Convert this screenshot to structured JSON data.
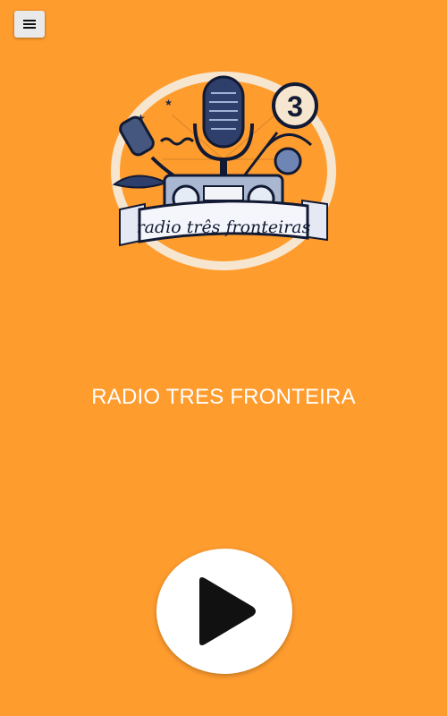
{
  "header": {
    "menu_icon": "hamburger-menu-icon"
  },
  "logo": {
    "banner_text": "radio três fronteiras",
    "badge_number": "3"
  },
  "station": {
    "name": "RADIO TRES FRONTEIRA"
  },
  "player": {
    "play_icon": "play-icon"
  },
  "colors": {
    "background": "#FF9C2E",
    "logo_ring": "#F7E6CF",
    "icon_dark": "#1E2A4A"
  }
}
